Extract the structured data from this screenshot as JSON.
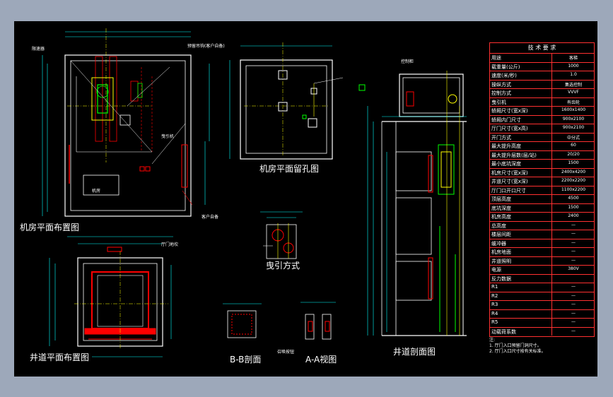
{
  "views": {
    "machine_room_layout": "机房平面布置图",
    "machine_room_holes": "机房平面留孔图",
    "shaft_plan": "井道平面布置图",
    "traction": "曳引方式",
    "section_bb": "B-B剖面",
    "view_aa": "A-A视图",
    "shaft_section": "井道剖面图"
  },
  "annotations": {
    "traction_machine": "曳引机",
    "ceiling_hook": "预留吊钩(客户自备)",
    "control_cabinet": "控制柜",
    "governor": "限速器",
    "owner_supply": "客户自备",
    "machine_room": "机房",
    "door_sill": "厅门地坎",
    "landing_button": "召唤按钮"
  },
  "spec_table": {
    "title": "技 术 要 求",
    "rows": [
      {
        "k": "用途",
        "v": "客梯"
      },
      {
        "k": "载重量(公斤)",
        "v": "1000"
      },
      {
        "k": "速度(米/秒)",
        "v": "1.0"
      },
      {
        "k": "操纵方式",
        "v": "集选控制"
      },
      {
        "k": "控制方式",
        "v": "VVVF"
      },
      {
        "k": "曳引机",
        "v": "有齿轮"
      },
      {
        "k": "轿厢尺寸(宽x深)",
        "v": "1600x1400"
      },
      {
        "k": "轿厢内门尺寸",
        "v": "900x2100"
      },
      {
        "k": "厅门尺寸(宽x高)",
        "v": "900x2100"
      },
      {
        "k": "开门方式",
        "v": "中分式"
      },
      {
        "k": "最大提升高度",
        "v": "60"
      },
      {
        "k": "最大提升层数(层/站)",
        "v": "20/20"
      },
      {
        "k": "最小底坑深度",
        "v": "1500"
      },
      {
        "k": "机房尺寸(宽x深)",
        "v": "2400x4200"
      },
      {
        "k": "井道尺寸(宽x深)",
        "v": "2200x2200"
      },
      {
        "k": "厅门口开口尺寸",
        "v": "1100x2200"
      },
      {
        "k": "顶层高度",
        "v": "4500"
      },
      {
        "k": "底坑深度",
        "v": "1500"
      },
      {
        "k": "机房高度",
        "v": "2400"
      },
      {
        "k": "总高度",
        "v": "—"
      },
      {
        "k": "楼层间距",
        "v": "—"
      },
      {
        "k": "缓冲器",
        "v": "—"
      },
      {
        "k": "机房地面",
        "v": "—"
      },
      {
        "k": "井道照明",
        "v": "—"
      },
      {
        "k": "电源",
        "v": "380V"
      },
      {
        "k": "反力数据",
        "v": ""
      },
      {
        "k": "R1",
        "v": "—"
      },
      {
        "k": "R2",
        "v": "—"
      },
      {
        "k": "R3",
        "v": "—"
      },
      {
        "k": "R4",
        "v": "—"
      },
      {
        "k": "R5",
        "v": "—"
      },
      {
        "k": "动载荷系数",
        "v": "—"
      }
    ]
  },
  "notes": [
    "注:",
    "1. 厅门入口预留门洞尺寸。",
    "2. 厅门入口尺寸按有关标准。"
  ]
}
